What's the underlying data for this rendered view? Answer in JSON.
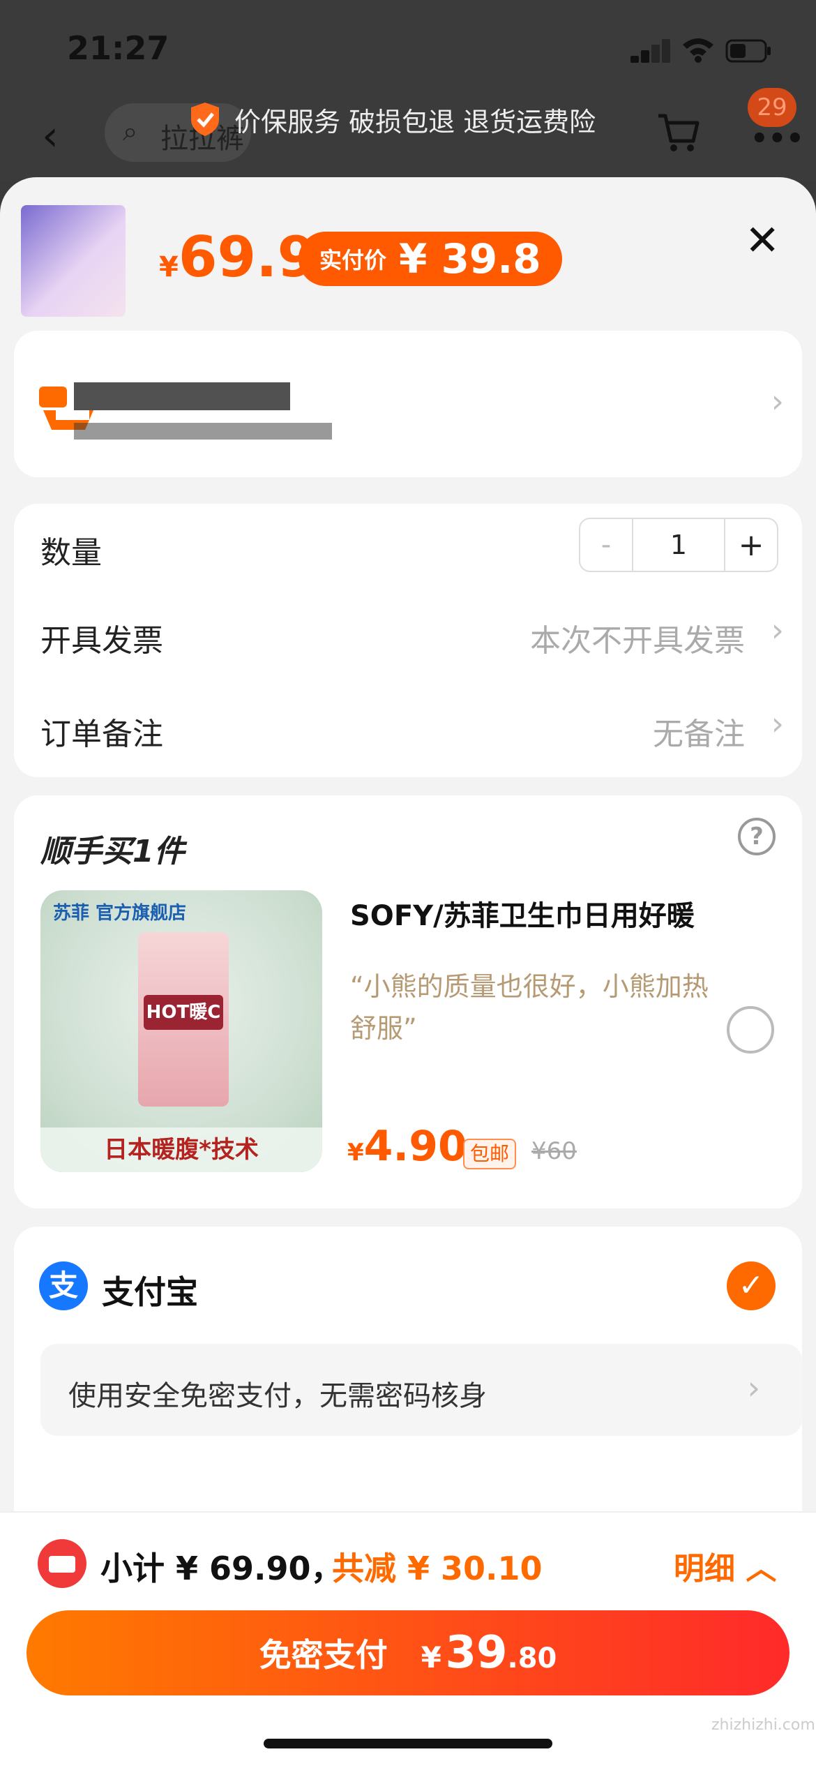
{
  "status_bar": {
    "time": "21:27"
  },
  "background_header": {
    "search_placeholder": "拉拉裤",
    "guarantee_text": "价保服务 破损包退 退货运费险",
    "cart_count": "29"
  },
  "sheet": {
    "price_currency": "¥",
    "price": "69.9",
    "real_price_label": "实付价",
    "real_price": "¥ 39.8",
    "address": {
      "blurred": true
    },
    "options": {
      "quantity_label": "数量",
      "quantity_value": "1",
      "minus": "-",
      "plus": "+",
      "invoice_label": "开具发票",
      "invoice_value": "本次不开具发票",
      "remark_label": "订单备注",
      "remark_value": "无备注"
    },
    "add_on": {
      "title": "顺手买1件",
      "help": "?",
      "store_tag": "苏菲 官方旗舰店",
      "box_label": "HOT暖C",
      "image_caption": "日本暖腹*技术",
      "product_title": "SOFY/苏菲卫生巾日用好暖",
      "quote": "“小熊的质量也很好，小熊加热舒服”",
      "price_currency": "¥",
      "price": "4.90",
      "free_shipping": "包邮",
      "original_price": "¥60"
    },
    "payment": {
      "method_icon": "支",
      "method": "支付宝",
      "check": "✓",
      "secure_text": "使用安全免密支付，无需密码核身"
    }
  },
  "bottom": {
    "subtotal": "小计 ¥ 69.90，",
    "discount": "共减 ¥ 30.10",
    "detail": "明细 ︿",
    "pay_label": "免密支付",
    "pay_currency": "¥",
    "pay_int": "39",
    "pay_dec": ".80",
    "watermark": "zhizhizhi.com"
  },
  "colors": {
    "accent": "#ff5a00",
    "alipay": "#1677ff",
    "button_end": "#ff2a2a"
  }
}
